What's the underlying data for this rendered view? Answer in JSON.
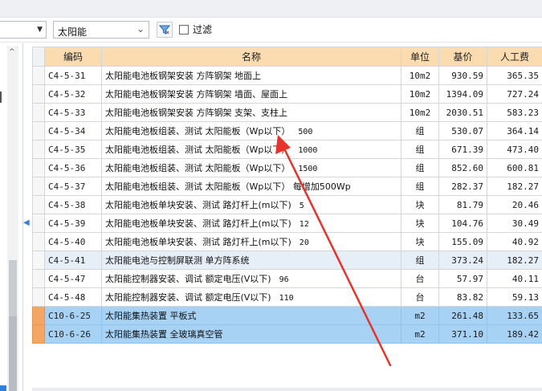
{
  "toolbar": {
    "category_value": "太阳能",
    "filter_label": "过滤"
  },
  "columns": {
    "code": "编码",
    "name": "名称",
    "unit": "单位",
    "base_price": "基价",
    "labor": "人工费"
  },
  "rows": [
    {
      "code": "C4-5-31",
      "name": "太阳能电池板钢架安装 方阵钢架 地面上",
      "ext": "",
      "unit": "10m2",
      "price": "930.59",
      "labor": "365.35"
    },
    {
      "code": "C4-5-32",
      "name": "太阳能电池板钢架安装 方阵钢架 墙面、屋面上",
      "ext": "",
      "unit": "10m2",
      "price": "1394.09",
      "labor": "727.24"
    },
    {
      "code": "C4-5-33",
      "name": "太阳能电池板钢架安装 方阵钢架 支架、支柱上",
      "ext": "",
      "unit": "10m2",
      "price": "2030.51",
      "labor": "583.23"
    },
    {
      "code": "C4-5-34",
      "name": "太阳能电池板组装、测试 太阳能板（Wp以下）",
      "ext": "500",
      "unit": "组",
      "price": "530.07",
      "labor": "364.14"
    },
    {
      "code": "C4-5-35",
      "name": "太阳能电池板组装、测试 太阳能板（Wp以下）",
      "ext": "1000",
      "unit": "组",
      "price": "671.39",
      "labor": "473.40"
    },
    {
      "code": "C4-5-36",
      "name": "太阳能电池板组装、测试 太阳能板（Wp以下）",
      "ext": "1500",
      "unit": "组",
      "price": "852.60",
      "labor": "600.81"
    },
    {
      "code": "C4-5-37",
      "name": "太阳能电池板组装、测试 太阳能板（Wp以下） 每增加500Wp",
      "ext": "",
      "unit": "组",
      "price": "282.37",
      "labor": "182.27"
    },
    {
      "code": "C4-5-38",
      "name": "太阳能电池板单块安装、测试 路灯杆上(m以下)",
      "ext": "5",
      "unit": "块",
      "price": "81.79",
      "labor": "20.46"
    },
    {
      "code": "C4-5-39",
      "name": "太阳能电池板单块安装、测试 路灯杆上(m以下)",
      "ext": "12",
      "unit": "块",
      "price": "104.76",
      "labor": "30.49"
    },
    {
      "code": "C4-5-40",
      "name": "太阳能电池板单块安装、测试 路灯杆上(m以下)",
      "ext": "20",
      "unit": "块",
      "price": "155.09",
      "labor": "40.92"
    },
    {
      "code": "C4-5-41",
      "name": "太阳能电池与控制屏联测 单方阵系统",
      "ext": "",
      "unit": "组",
      "price": "373.24",
      "labor": "182.27"
    },
    {
      "code": "C4-5-47",
      "name": "太阳能控制器安装、调试 额定电压(V以下)",
      "ext": "96",
      "unit": "台",
      "price": "57.97",
      "labor": "40.11"
    },
    {
      "code": "C4-5-48",
      "name": "太阳能控制器安装、调试 额定电压(V以下)",
      "ext": "110",
      "unit": "台",
      "price": "83.82",
      "labor": "59.13"
    },
    {
      "code": "C10-6-25",
      "name": "太阳能集热装置 平板式",
      "ext": "",
      "unit": "m2",
      "price": "261.48",
      "labor": "133.65"
    },
    {
      "code": "C10-6-26",
      "name": "太阳能集热装置 全玻璃真空管",
      "ext": "",
      "unit": "m2",
      "price": "371.10",
      "labor": "189.42"
    }
  ],
  "colors": {
    "header_bg": "#fbdcb0",
    "selected_row_bg": "#a8d2f4",
    "selected_marker_bg": "#f4a765",
    "annotation_arrow": "#e8322a"
  }
}
